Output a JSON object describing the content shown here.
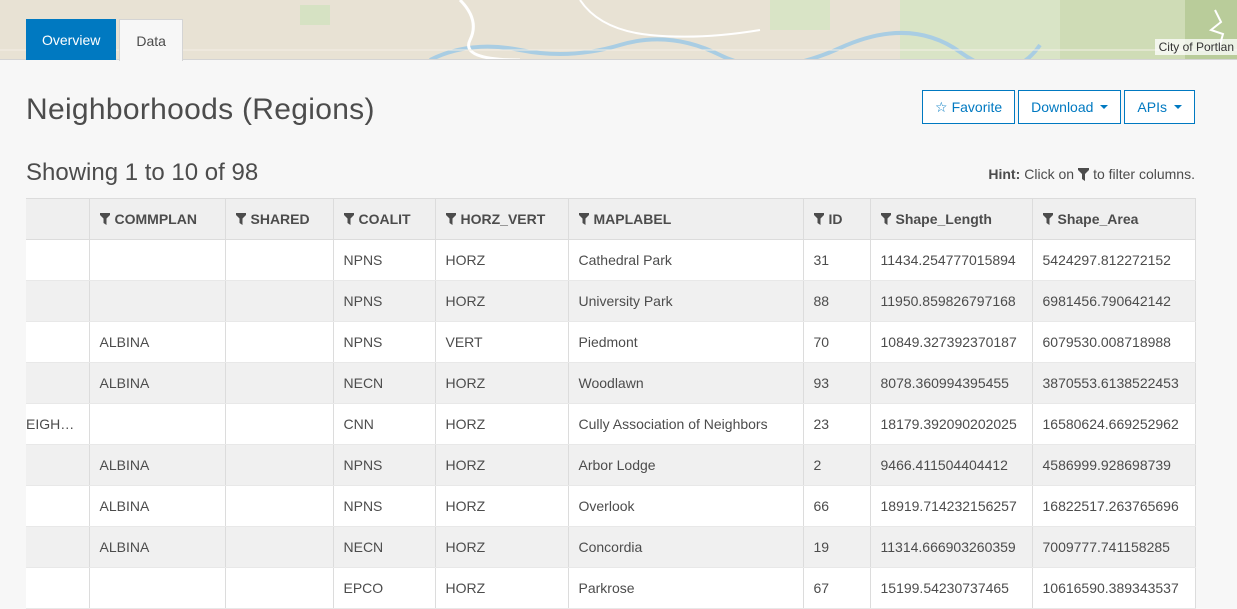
{
  "map": {
    "attribution": "City of Portlan"
  },
  "tabs": [
    {
      "label": "Overview",
      "active": true
    },
    {
      "label": "Data",
      "active": false
    }
  ],
  "page_title": "Neighborhoods (Regions)",
  "actions": {
    "favorite_label": "Favorite",
    "download_label": "Download",
    "apis_label": "APIs"
  },
  "showing_text": "Showing 1 to 10 of 98",
  "hint": {
    "bold": "Hint:",
    "before": "Click on",
    "after": "to filter columns."
  },
  "table": {
    "columns": [
      "",
      "COMMPLAN",
      "SHARED",
      "COALIT",
      "HORZ_VERT",
      "MAPLABEL",
      "ID",
      "Shape_Length",
      "Shape_Area"
    ],
    "rows": [
      [
        "",
        "",
        "",
        "NPNS",
        "HORZ",
        "Cathedral Park",
        "31",
        "11434.254777015894",
        "5424297.812272152"
      ],
      [
        "",
        "",
        "",
        "NPNS",
        "HORZ",
        "University Park",
        "88",
        "11950.859826797168",
        "6981456.790642142"
      ],
      [
        "",
        "ALBINA",
        "",
        "NPNS",
        "VERT",
        "Piedmont",
        "70",
        "10849.327392370187",
        "6079530.008718988"
      ],
      [
        "",
        "ALBINA",
        "",
        "NECN",
        "HORZ",
        "Woodlawn",
        "93",
        "8078.360994395455",
        "3870553.6138522453"
      ],
      [
        "EIGH…",
        "",
        "",
        "CNN",
        "HORZ",
        "Cully Association of Neighbors",
        "23",
        "18179.392090202025",
        "16580624.669252962"
      ],
      [
        "",
        "ALBINA",
        "",
        "NPNS",
        "HORZ",
        "Arbor Lodge",
        "2",
        "9466.411504404412",
        "4586999.928698739"
      ],
      [
        "",
        "ALBINA",
        "",
        "NPNS",
        "HORZ",
        "Overlook",
        "66",
        "18919.714232156257",
        "16822517.263765696"
      ],
      [
        "",
        "ALBINA",
        "",
        "NECN",
        "HORZ",
        "Concordia",
        "19",
        "11314.666903260359",
        "7009777.741158285"
      ],
      [
        "",
        "",
        "",
        "EPCO",
        "HORZ",
        "Parkrose",
        "67",
        "15199.54230737465",
        "10616590.389343537"
      ]
    ]
  },
  "colors": {
    "accent": "#0079c1",
    "text": "#4c4c4c",
    "row_alt": "#f0f0f0"
  }
}
